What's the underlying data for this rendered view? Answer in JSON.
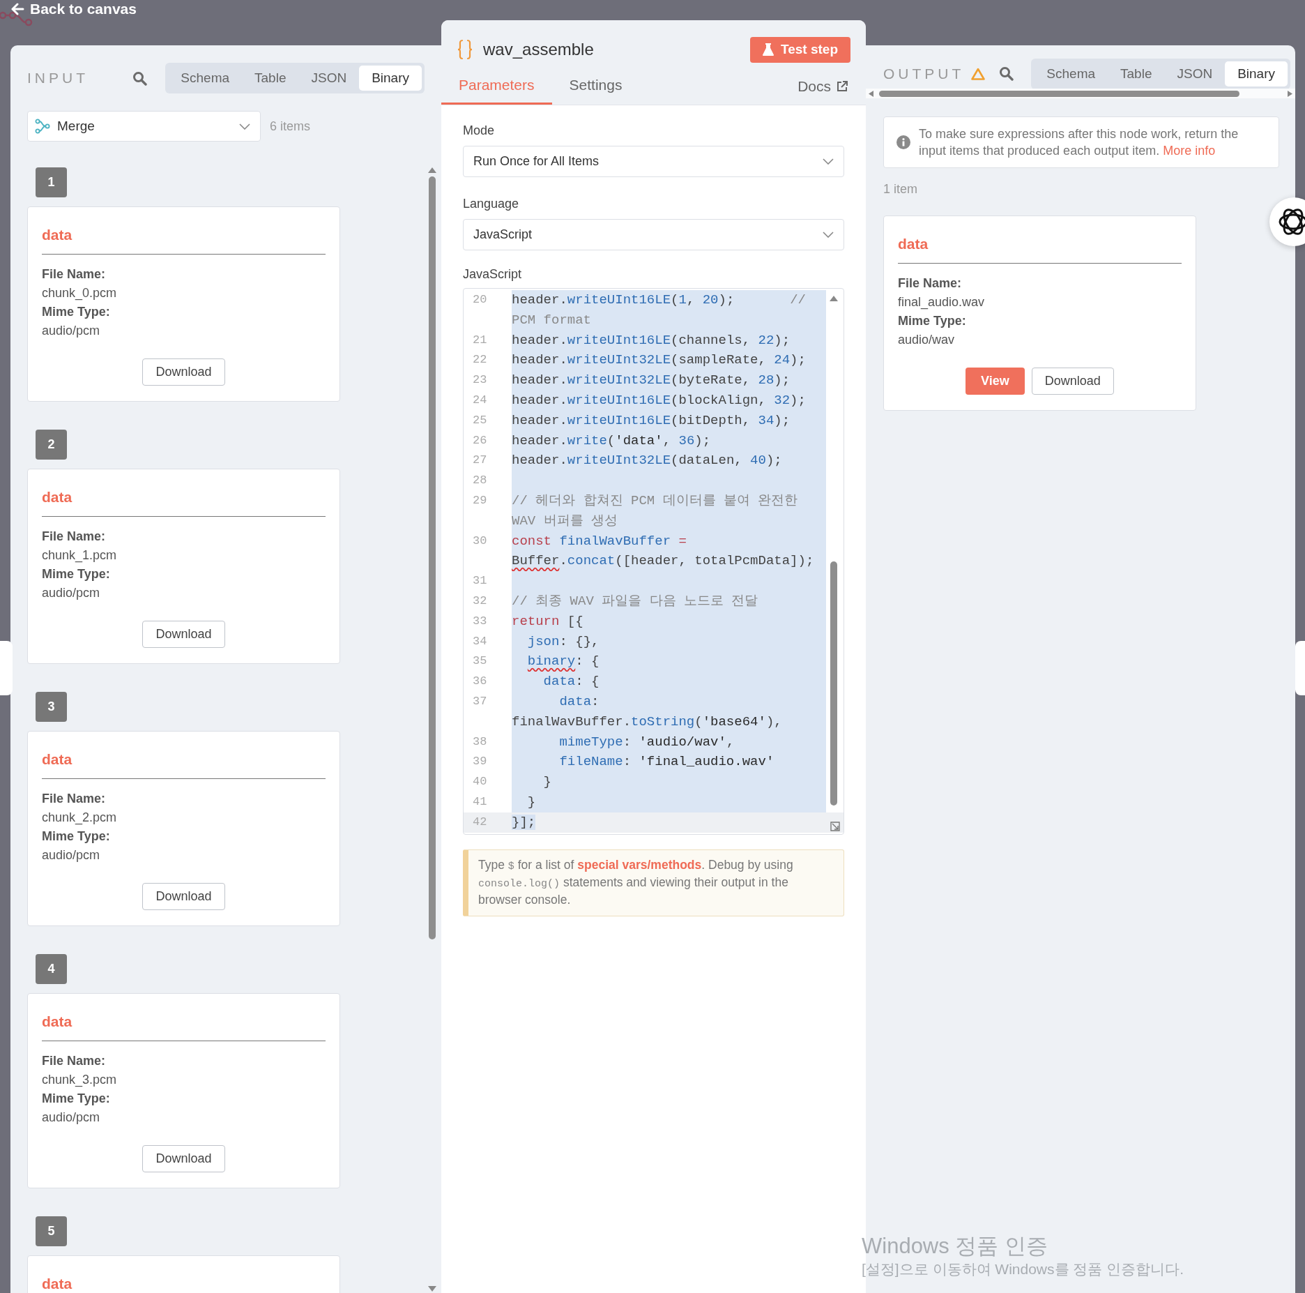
{
  "top_bar": {
    "back_label": "Back to canvas"
  },
  "input": {
    "title": "INPUT",
    "tabs": [
      {
        "label": "Schema",
        "selected": false
      },
      {
        "label": "Table",
        "selected": false
      },
      {
        "label": "JSON",
        "selected": false
      },
      {
        "label": "Binary",
        "selected": true
      }
    ],
    "source": "Merge",
    "count": "6 items",
    "items": [
      {
        "index": "1",
        "title": "data",
        "fields": [
          {
            "label": "File Name:",
            "value": "chunk_0.pcm"
          },
          {
            "label": "Mime Type:",
            "value": "audio/pcm"
          }
        ],
        "buttons": [
          {
            "label": "Download",
            "kind": "secondary"
          }
        ]
      },
      {
        "index": "2",
        "title": "data",
        "fields": [
          {
            "label": "File Name:",
            "value": "chunk_1.pcm"
          },
          {
            "label": "Mime Type:",
            "value": "audio/pcm"
          }
        ],
        "buttons": [
          {
            "label": "Download",
            "kind": "secondary"
          }
        ]
      },
      {
        "index": "3",
        "title": "data",
        "fields": [
          {
            "label": "File Name:",
            "value": "chunk_2.pcm"
          },
          {
            "label": "Mime Type:",
            "value": "audio/pcm"
          }
        ],
        "buttons": [
          {
            "label": "Download",
            "kind": "secondary"
          }
        ]
      },
      {
        "index": "4",
        "title": "data",
        "fields": [
          {
            "label": "File Name:",
            "value": "chunk_3.pcm"
          },
          {
            "label": "Mime Type:",
            "value": "audio/pcm"
          }
        ],
        "buttons": [
          {
            "label": "Download",
            "kind": "secondary"
          }
        ]
      },
      {
        "index": "5",
        "title": "data"
      }
    ]
  },
  "node": {
    "title": "wav_assemble",
    "test_button": "Test step",
    "tabs": [
      {
        "label": "Parameters",
        "selected": true
      },
      {
        "label": "Settings",
        "selected": false
      }
    ],
    "docs_link": "Docs",
    "fields": [
      {
        "label": "Mode",
        "value": "Run Once for All Items"
      },
      {
        "label": "Language",
        "value": "JavaScript"
      }
    ],
    "code_label": "JavaScript",
    "code_lines": [
      {
        "number": "20",
        "selected": true,
        "active": false,
        "tokens": [
          {
            "kind": "plain",
            "text": "header."
          },
          {
            "kind": "fn",
            "text": "writeUInt16LE"
          },
          {
            "kind": "plain",
            "text": "("
          },
          {
            "kind": "num",
            "text": "1"
          },
          {
            "kind": "plain",
            "text": ", "
          },
          {
            "kind": "num",
            "text": "20"
          },
          {
            "kind": "plain",
            "text": ");       "
          },
          {
            "kind": "cmt",
            "text": "// PCM format"
          }
        ]
      },
      {
        "number": "21",
        "selected": true,
        "active": false,
        "tokens": [
          {
            "kind": "plain",
            "text": "header."
          },
          {
            "kind": "fn",
            "text": "writeUInt16LE"
          },
          {
            "kind": "plain",
            "text": "(channels, "
          },
          {
            "kind": "num",
            "text": "22"
          },
          {
            "kind": "plain",
            "text": ");"
          }
        ]
      },
      {
        "number": "22",
        "selected": true,
        "active": false,
        "tokens": [
          {
            "kind": "plain",
            "text": "header."
          },
          {
            "kind": "fn",
            "text": "writeUInt32LE"
          },
          {
            "kind": "plain",
            "text": "(sampleRate, "
          },
          {
            "kind": "num",
            "text": "24"
          },
          {
            "kind": "plain",
            "text": ");"
          }
        ]
      },
      {
        "number": "23",
        "selected": true,
        "active": false,
        "tokens": [
          {
            "kind": "plain",
            "text": "header."
          },
          {
            "kind": "fn",
            "text": "writeUInt32LE"
          },
          {
            "kind": "plain",
            "text": "(byteRate, "
          },
          {
            "kind": "num",
            "text": "28"
          },
          {
            "kind": "plain",
            "text": ");"
          }
        ]
      },
      {
        "number": "24",
        "selected": true,
        "active": false,
        "tokens": [
          {
            "kind": "plain",
            "text": "header."
          },
          {
            "kind": "fn",
            "text": "writeUInt16LE"
          },
          {
            "kind": "plain",
            "text": "(blockAlign, "
          },
          {
            "kind": "num",
            "text": "32"
          },
          {
            "kind": "plain",
            "text": ");"
          }
        ]
      },
      {
        "number": "25",
        "selected": true,
        "active": false,
        "tokens": [
          {
            "kind": "plain",
            "text": "header."
          },
          {
            "kind": "fn",
            "text": "writeUInt16LE"
          },
          {
            "kind": "plain",
            "text": "(bitDepth, "
          },
          {
            "kind": "num",
            "text": "34"
          },
          {
            "kind": "plain",
            "text": ");"
          }
        ]
      },
      {
        "number": "26",
        "selected": true,
        "active": false,
        "tokens": [
          {
            "kind": "plain",
            "text": "header."
          },
          {
            "kind": "fn",
            "text": "write"
          },
          {
            "kind": "plain",
            "text": "("
          },
          {
            "kind": "str",
            "text": "'data'"
          },
          {
            "kind": "plain",
            "text": ", "
          },
          {
            "kind": "num",
            "text": "36"
          },
          {
            "kind": "plain",
            "text": ");"
          }
        ]
      },
      {
        "number": "27",
        "selected": true,
        "active": false,
        "tokens": [
          {
            "kind": "plain",
            "text": "header."
          },
          {
            "kind": "fn",
            "text": "writeUInt32LE"
          },
          {
            "kind": "plain",
            "text": "(dataLen, "
          },
          {
            "kind": "num",
            "text": "40"
          },
          {
            "kind": "plain",
            "text": ");"
          }
        ]
      },
      {
        "number": "28",
        "selected": true,
        "active": false
      },
      {
        "number": "29",
        "selected": true,
        "active": false,
        "tokens": [
          {
            "kind": "cmt",
            "text": "// 헤더와 합쳐진 PCM 데이터를 붙여 완전한 WAV 버퍼를 생성"
          }
        ]
      },
      {
        "number": "30",
        "selected": true,
        "active": false,
        "tokens": [
          {
            "kind": "kw",
            "text": "const"
          },
          {
            "kind": "fn",
            "text": " finalWavBuffer"
          },
          {
            "kind": "kw",
            "text": " = "
          },
          {
            "kind": "plain",
            "text": "Buffer",
            "flagged": true
          },
          {
            "kind": "plain",
            "text": "."
          },
          {
            "kind": "fn",
            "text": "concat"
          },
          {
            "kind": "plain",
            "text": "([header, totalPcmData]);"
          }
        ]
      },
      {
        "number": "31",
        "selected": true,
        "active": false
      },
      {
        "number": "32",
        "selected": true,
        "active": false,
        "tokens": [
          {
            "kind": "cmt",
            "text": "// 최종 WAV 파일을 다음 노드로 전달"
          }
        ]
      },
      {
        "number": "33",
        "selected": true,
        "active": false,
        "tokens": [
          {
            "kind": "kw",
            "text": "return"
          },
          {
            "kind": "plain",
            "text": " [{"
          }
        ]
      },
      {
        "number": "34",
        "selected": true,
        "active": false,
        "tokens": [
          {
            "kind": "fn",
            "text": "  json"
          },
          {
            "kind": "plain",
            "text": ": {},"
          }
        ]
      },
      {
        "number": "35",
        "selected": true,
        "active": false,
        "tokens": [
          {
            "kind": "fn",
            "text": "  binary",
            "flagged": true
          },
          {
            "kind": "plain",
            "text": ": {"
          }
        ]
      },
      {
        "number": "36",
        "selected": true,
        "active": false,
        "tokens": [
          {
            "kind": "fn",
            "text": "    data"
          },
          {
            "kind": "plain",
            "text": ": {"
          }
        ]
      },
      {
        "number": "37",
        "selected": true,
        "active": false,
        "tokens": [
          {
            "kind": "fn",
            "text": "      data"
          },
          {
            "kind": "plain",
            "text": ": finalWavBuffer."
          },
          {
            "kind": "fn",
            "text": "toString"
          },
          {
            "kind": "plain",
            "text": "("
          },
          {
            "kind": "str",
            "text": "'base64'"
          },
          {
            "kind": "plain",
            "text": "),"
          }
        ]
      },
      {
        "number": "38",
        "selected": true,
        "active": false,
        "tokens": [
          {
            "kind": "fn",
            "text": "      mimeType"
          },
          {
            "kind": "plain",
            "text": ": "
          },
          {
            "kind": "str",
            "text": "'audio/wav'"
          },
          {
            "kind": "plain",
            "text": ","
          }
        ]
      },
      {
        "number": "39",
        "selected": true,
        "active": false,
        "tokens": [
          {
            "kind": "fn",
            "text": "      fileName"
          },
          {
            "kind": "plain",
            "text": ": "
          },
          {
            "kind": "str",
            "text": "'final_audio.wav'"
          }
        ]
      },
      {
        "number": "40",
        "selected": true,
        "active": false,
        "tokens": [
          {
            "kind": "plain",
            "text": "    }"
          }
        ]
      },
      {
        "number": "41",
        "selected": true,
        "active": false,
        "tokens": [
          {
            "kind": "plain",
            "text": "  }"
          }
        ]
      },
      {
        "number": "42",
        "selected": true,
        "active": true,
        "tokens": [
          {
            "kind": "plain",
            "text": "}];"
          }
        ]
      }
    ],
    "hint": [
      {
        "kind": "text",
        "text": "Type "
      },
      {
        "kind": "code",
        "text": "$"
      },
      {
        "kind": "text",
        "text": " for a list of "
      },
      {
        "kind": "link",
        "text": "special vars/methods"
      },
      {
        "kind": "text",
        "text": ". Debug by using "
      },
      {
        "kind": "code",
        "text": "console.log()"
      },
      {
        "kind": "text",
        "text": " statements and viewing their output in the browser console."
      }
    ]
  },
  "output": {
    "title": "OUTPUT",
    "tabs": [
      {
        "label": "Schema",
        "selected": false
      },
      {
        "label": "Table",
        "selected": false
      },
      {
        "label": "JSON",
        "selected": false
      },
      {
        "label": "Binary",
        "selected": true
      }
    ],
    "notice": {
      "text": "To make sure expressions after this node work, return the input items that produced each output item.",
      "link": "More info"
    },
    "count": "1 item",
    "items": [
      {
        "title": "data",
        "fields": [
          {
            "label": "File Name:",
            "value": "final_audio.wav"
          },
          {
            "label": "Mime Type:",
            "value": "audio/wav"
          }
        ],
        "buttons": [
          {
            "label": "View",
            "kind": "primary"
          },
          {
            "label": "Download",
            "kind": "secondary"
          }
        ]
      }
    ]
  },
  "watermark": {
    "title": "Windows 정품 인증",
    "text": "[설정]으로 이동하여 Windows를 정품 인증합니다."
  }
}
